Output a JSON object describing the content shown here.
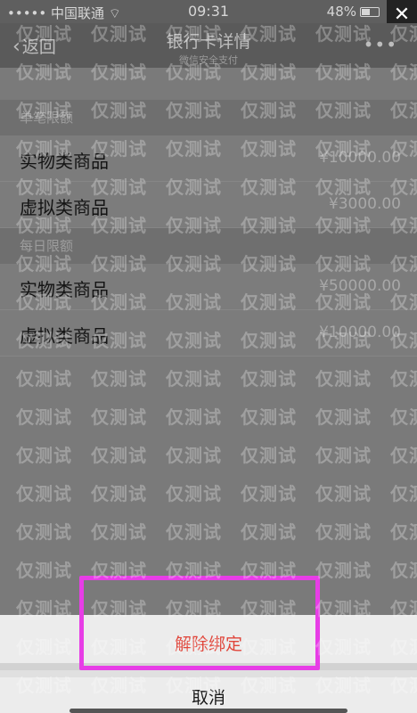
{
  "status_bar": {
    "carrier": "••••• 中国联通 ",
    "wifi_icon": "wifi-icon",
    "time": "09:31",
    "battery": "48%"
  },
  "close_label": "✕",
  "nav": {
    "back_label": "返回",
    "title": "银行卡详情",
    "subtitle": "微信安全支付",
    "more_label": "•••"
  },
  "sections": [
    {
      "title": "单笔限额",
      "rows": [
        {
          "name": "实物类商品",
          "amount": "¥10000.00"
        },
        {
          "name": "虚拟类商品",
          "amount": "¥3000.00"
        }
      ]
    },
    {
      "title": "每日限额",
      "rows": [
        {
          "name": "实物类商品",
          "amount": "¥50000.00"
        },
        {
          "name": "虚拟类商品",
          "amount": "¥10000.00"
        }
      ]
    }
  ],
  "sheet": {
    "action_label": "解除绑定",
    "cancel_label": "取消"
  },
  "watermark": "仅测试",
  "colors": {
    "destructive": "#e0453a",
    "highlight": "#e73de6",
    "accent_green": "#3ea84e"
  }
}
